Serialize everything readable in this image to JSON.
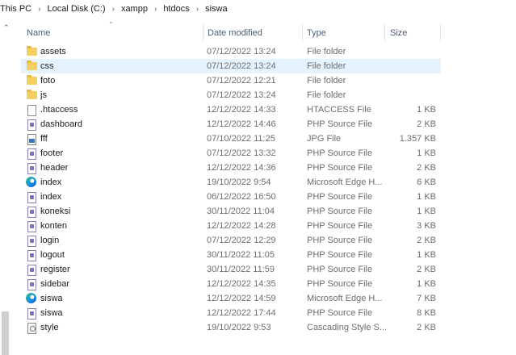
{
  "breadcrumb": [
    "This PC",
    "Local Disk (C:)",
    "xampp",
    "htdocs",
    "siswa"
  ],
  "columns": {
    "name": "Name",
    "date": "Date modified",
    "type": "Type",
    "size": "Size"
  },
  "files": [
    {
      "name": "assets",
      "date": "07/12/2022 13:24",
      "type": "File folder",
      "size": "",
      "icon": "folder-icon"
    },
    {
      "name": "css",
      "date": "07/12/2022 13:24",
      "type": "File folder",
      "size": "",
      "icon": "folder-icon",
      "selected": true
    },
    {
      "name": "foto",
      "date": "07/12/2022 12:21",
      "type": "File folder",
      "size": "",
      "icon": "folder-icon"
    },
    {
      "name": "js",
      "date": "07/12/2022 13:24",
      "type": "File folder",
      "size": "",
      "icon": "folder-icon"
    },
    {
      "name": ".htaccess",
      "date": "12/12/2022 14:33",
      "type": "HTACCESS File",
      "size": "1 KB",
      "icon": "file-icon"
    },
    {
      "name": "dashboard",
      "date": "12/12/2022 14:46",
      "type": "PHP Source File",
      "size": "2 KB",
      "icon": "php-file-icon"
    },
    {
      "name": "fff",
      "date": "07/10/2022 11:25",
      "type": "JPG File",
      "size": "1.357 KB",
      "icon": "jpg-file-icon"
    },
    {
      "name": "footer",
      "date": "07/12/2022 13:32",
      "type": "PHP Source File",
      "size": "1 KB",
      "icon": "php-file-icon"
    },
    {
      "name": "header",
      "date": "12/12/2022 14:36",
      "type": "PHP Source File",
      "size": "2 KB",
      "icon": "php-file-icon"
    },
    {
      "name": "index",
      "date": "19/10/2022 9:54",
      "type": "Microsoft Edge H...",
      "size": "6 KB",
      "icon": "edge-icon"
    },
    {
      "name": "index",
      "date": "06/12/2022 16:50",
      "type": "PHP Source File",
      "size": "1 KB",
      "icon": "php-file-icon"
    },
    {
      "name": "koneksi",
      "date": "30/11/2022 11:04",
      "type": "PHP Source File",
      "size": "1 KB",
      "icon": "php-file-icon"
    },
    {
      "name": "konten",
      "date": "12/12/2022 14:28",
      "type": "PHP Source File",
      "size": "3 KB",
      "icon": "php-file-icon"
    },
    {
      "name": "login",
      "date": "07/12/2022 12:29",
      "type": "PHP Source File",
      "size": "2 KB",
      "icon": "php-file-icon"
    },
    {
      "name": "logout",
      "date": "30/11/2022 11:05",
      "type": "PHP Source File",
      "size": "1 KB",
      "icon": "php-file-icon"
    },
    {
      "name": "register",
      "date": "30/11/2022 11:59",
      "type": "PHP Source File",
      "size": "2 KB",
      "icon": "php-file-icon"
    },
    {
      "name": "sidebar",
      "date": "12/12/2022 14:35",
      "type": "PHP Source File",
      "size": "1 KB",
      "icon": "php-file-icon"
    },
    {
      "name": "siswa",
      "date": "12/12/2022 14:59",
      "type": "Microsoft Edge H...",
      "size": "7 KB",
      "icon": "edge-icon"
    },
    {
      "name": "siswa",
      "date": "12/12/2022 17:44",
      "type": "PHP Source File",
      "size": "8 KB",
      "icon": "php-file-icon"
    },
    {
      "name": "style",
      "date": "19/10/2022 9:53",
      "type": "Cascading Style S...",
      "size": "2 KB",
      "icon": "css-file-icon"
    }
  ]
}
